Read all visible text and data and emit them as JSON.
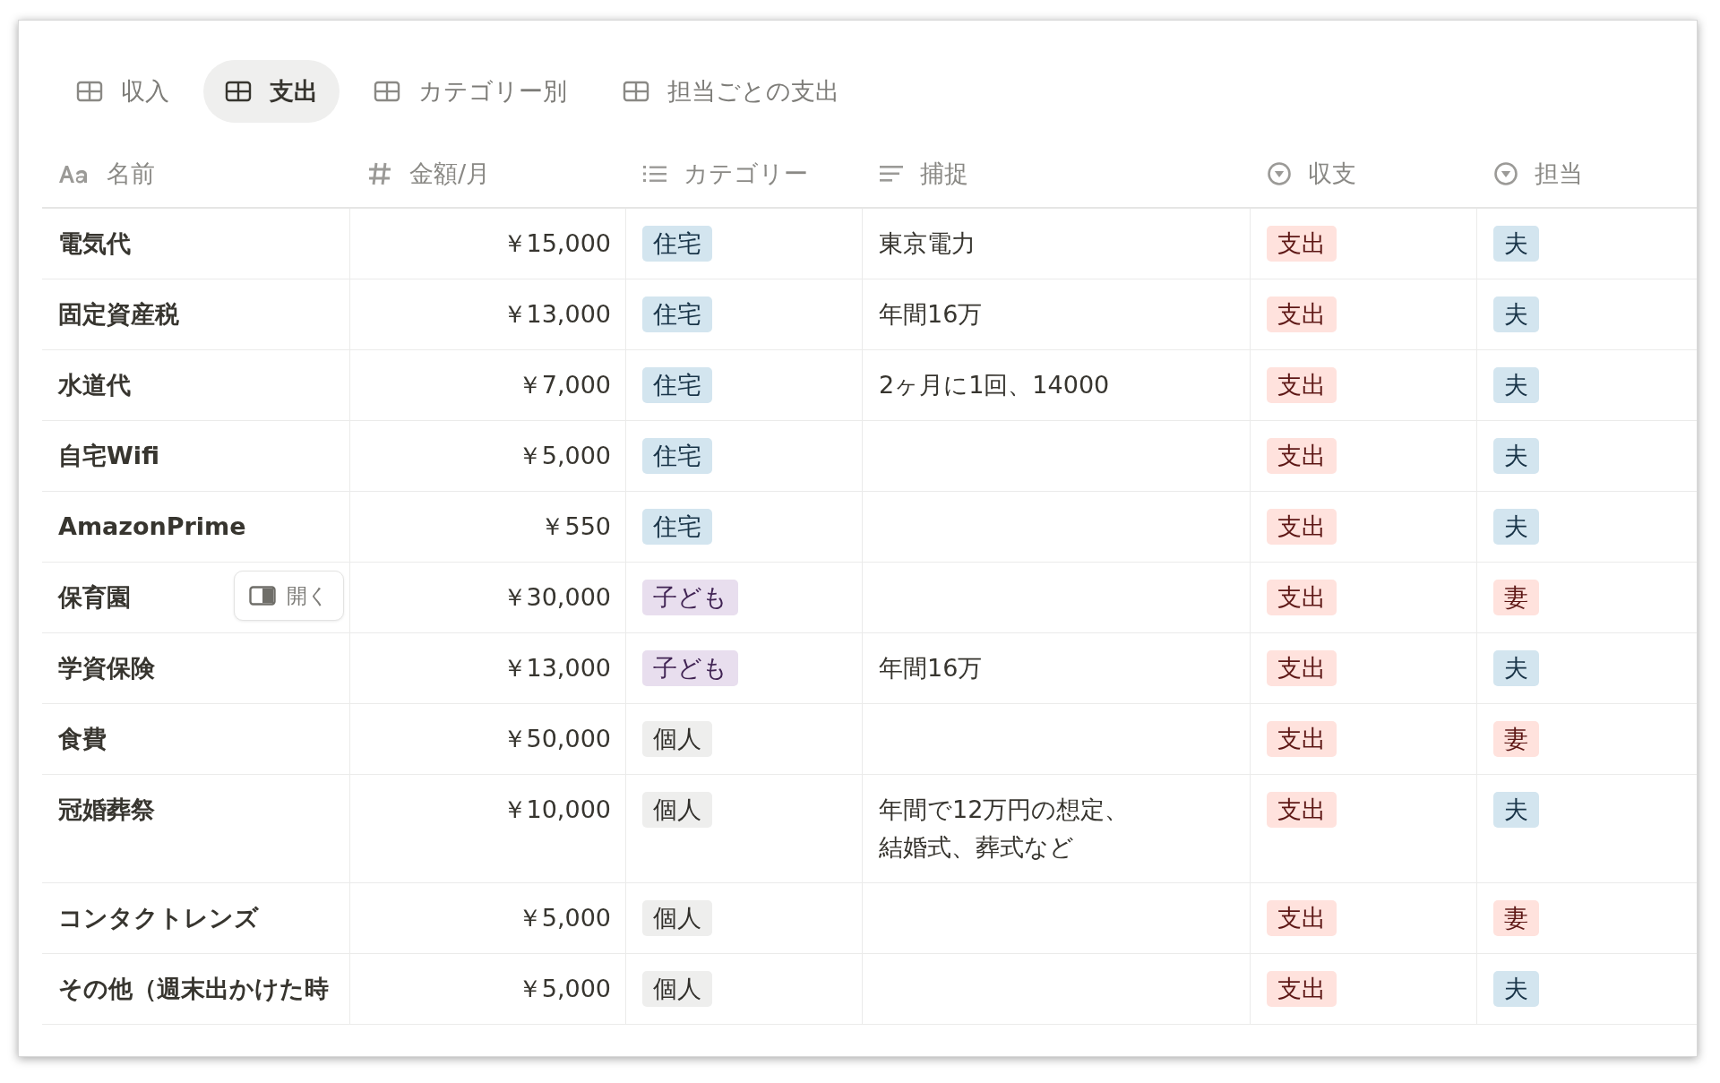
{
  "tabs": [
    {
      "label": "収入",
      "selected": false
    },
    {
      "label": "支出",
      "selected": true
    },
    {
      "label": "カテゴリー別",
      "selected": false
    },
    {
      "label": "担当ごとの支出",
      "selected": false
    }
  ],
  "columns": [
    {
      "label": "名前",
      "kind": "title"
    },
    {
      "label": "金額/月",
      "kind": "number"
    },
    {
      "label": "カテゴリー",
      "kind": "multi"
    },
    {
      "label": "捕捉",
      "kind": "text"
    },
    {
      "label": "収支",
      "kind": "select"
    },
    {
      "label": "担当",
      "kind": "select"
    }
  ],
  "rows": [
    {
      "name": "電気代",
      "amount": "￥15,000",
      "category": {
        "label": "住宅",
        "color": "#d3e5ef"
      },
      "note": "東京電力",
      "type": {
        "label": "支出",
        "color": "#ffe2dd"
      },
      "owner": {
        "label": "夫",
        "color": "#d3e5ef"
      }
    },
    {
      "name": "固定資産税",
      "amount": "￥13,000",
      "category": {
        "label": "住宅",
        "color": "#d3e5ef"
      },
      "note": "年間16万",
      "type": {
        "label": "支出",
        "color": "#ffe2dd"
      },
      "owner": {
        "label": "夫",
        "color": "#d3e5ef"
      }
    },
    {
      "name": "水道代",
      "amount": "￥7,000",
      "category": {
        "label": "住宅",
        "color": "#d3e5ef"
      },
      "note": "2ヶ月に1回、14000",
      "type": {
        "label": "支出",
        "color": "#ffe2dd"
      },
      "owner": {
        "label": "夫",
        "color": "#d3e5ef"
      }
    },
    {
      "name": "自宅Wifi",
      "amount": "￥5,000",
      "category": {
        "label": "住宅",
        "color": "#d3e5ef"
      },
      "type": {
        "label": "支出",
        "color": "#ffe2dd"
      },
      "owner": {
        "label": "夫",
        "color": "#d3e5ef"
      }
    },
    {
      "name": "AmazonPrime",
      "amount": "￥550",
      "category": {
        "label": "住宅",
        "color": "#d3e5ef"
      },
      "type": {
        "label": "支出",
        "color": "#ffe2dd"
      },
      "owner": {
        "label": "夫",
        "color": "#d3e5ef"
      }
    },
    {
      "name": "保育園",
      "open_button": "開く",
      "amount": "￥30,000",
      "category": {
        "label": "子ども",
        "color": "#e8deee"
      },
      "type": {
        "label": "支出",
        "color": "#ffe2dd"
      },
      "owner": {
        "label": "妻",
        "color": "#ffe2dd"
      }
    },
    {
      "name": "学資保険",
      "amount": "￥13,000",
      "category": {
        "label": "子ども",
        "color": "#e8deee"
      },
      "note": "年間16万",
      "type": {
        "label": "支出",
        "color": "#ffe2dd"
      },
      "owner": {
        "label": "夫",
        "color": "#d3e5ef"
      }
    },
    {
      "name": "食費",
      "amount": "￥50,000",
      "category": {
        "label": "個人",
        "color": "#eeeeed"
      },
      "type": {
        "label": "支出",
        "color": "#ffe2dd"
      },
      "owner": {
        "label": "妻",
        "color": "#ffe2dd"
      }
    },
    {
      "name": "冠婚葬祭",
      "amount": "￥10,000",
      "category": {
        "label": "個人",
        "color": "#eeeeed"
      },
      "note": "年間で12万円の想定、結婚式、葬式など",
      "type": {
        "label": "支出",
        "color": "#ffe2dd"
      },
      "owner": {
        "label": "夫",
        "color": "#d3e5ef"
      }
    },
    {
      "name": "コンタクトレンズ",
      "amount": "￥5,000",
      "category": {
        "label": "個人",
        "color": "#eeeeed"
      },
      "type": {
        "label": "支出",
        "color": "#ffe2dd"
      },
      "owner": {
        "label": "妻",
        "color": "#ffe2dd"
      }
    },
    {
      "name": "その他（週末出かけた時",
      "amount": "￥5,000",
      "category": {
        "label": "個人",
        "color": "#eeeeed"
      },
      "type": {
        "label": "支出",
        "color": "#ffe2dd"
      },
      "owner": {
        "label": "夫",
        "color": "#d3e5ef"
      }
    }
  ]
}
